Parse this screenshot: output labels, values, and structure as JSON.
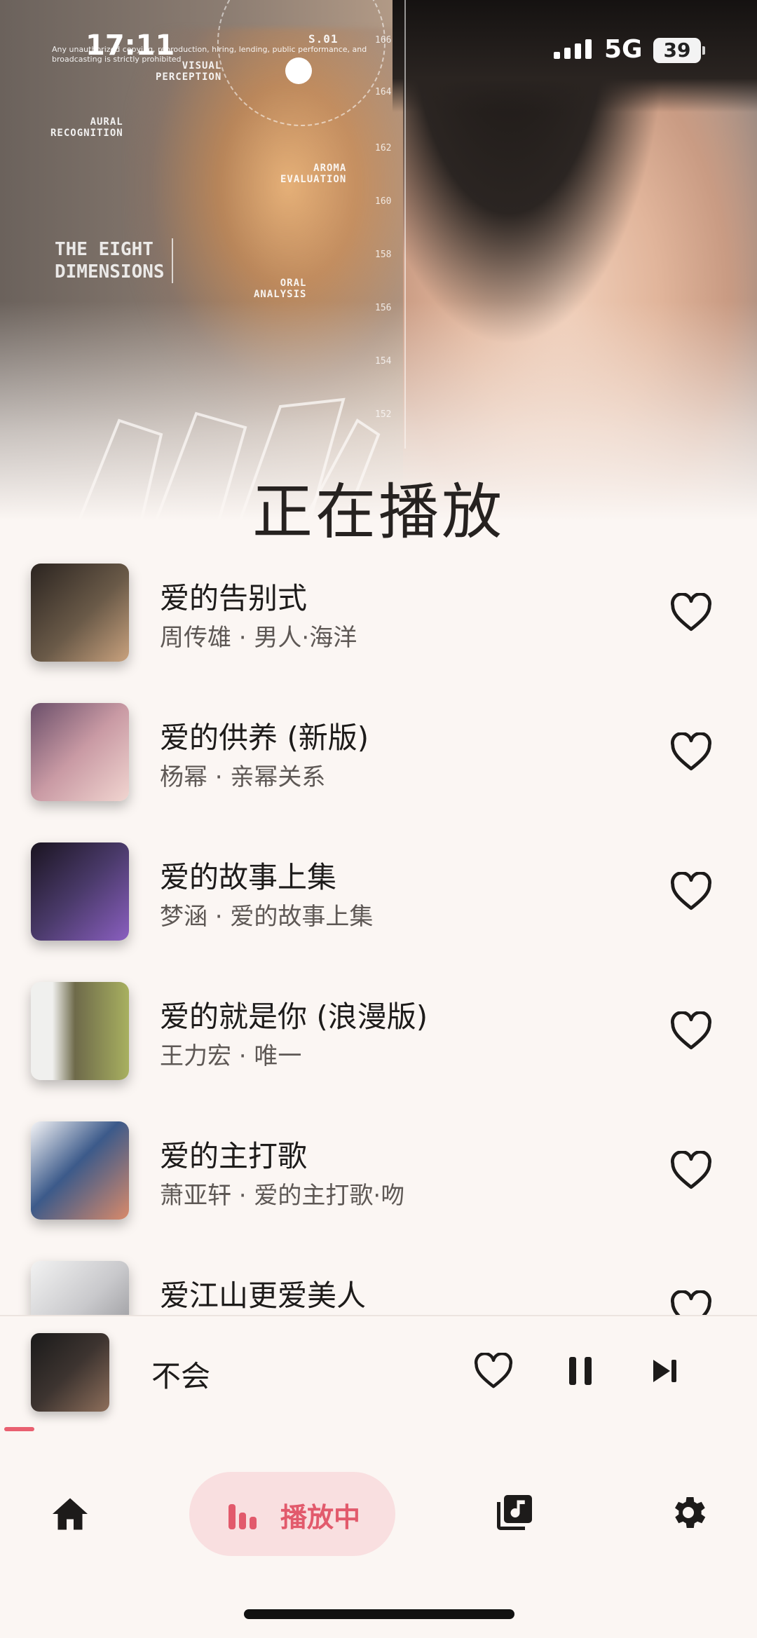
{
  "status_bar": {
    "time": "17:11",
    "network": "5G",
    "battery": "39",
    "signal_icon": "signal-icon"
  },
  "hero": {
    "title": "正在播放",
    "art_text": {
      "disclaimer": "Any unauthorized copying, reproduction, hiring, lending, public performance, and broadcasting is strictly prohibited",
      "visual_perception": "VISUAL\nPERCEPTION",
      "aural_recognition": "AURAL\nRECOGNITION",
      "aroma_evaluation": "AROMA\nEVALUATION",
      "oral_analysis": "ORAL\nANALYSIS",
      "eight_dimensions": "THE EIGHT\nDIMENSIONS",
      "scale_top": "S.01",
      "ticks": [
        "166",
        "164",
        "162",
        "160",
        "158",
        "156",
        "154",
        "152"
      ]
    }
  },
  "songs": [
    {
      "title": "爱的告别式",
      "subtitle": "周传雄 · 男人·海洋",
      "cover_colors": [
        "#2b2420",
        "#6a5a48",
        "#c9a27e"
      ]
    },
    {
      "title": "爱的供养 (新版)",
      "subtitle": "杨幂 · 亲幂关系",
      "cover_colors": [
        "#6b4f6a",
        "#c99aa4",
        "#f1d5d0"
      ]
    },
    {
      "title": "爱的故事上集",
      "subtitle": "梦涵 · 爱的故事上集",
      "cover_colors": [
        "#1a1420",
        "#4a3a6a",
        "#8a5fc0"
      ]
    },
    {
      "title": "爱的就是你 (浪漫版)",
      "subtitle": "王力宏 · 唯一",
      "cover_colors": [
        "#f0f0ee",
        "#6e6a4a",
        "#a8b060"
      ]
    },
    {
      "title": "爱的主打歌",
      "subtitle": "萧亚轩 · 爱的主打歌·吻",
      "cover_colors": [
        "#f4f4f6",
        "#3c5a8a",
        "#d98a6a"
      ]
    },
    {
      "title": "爱江山更爱美人",
      "subtitle": "",
      "cover_colors": [
        "#f2f2f2",
        "#c9c9cc",
        "#8a8a8e"
      ]
    }
  ],
  "mini_player": {
    "title": "不会",
    "progress": 0.04
  },
  "nav": {
    "home_icon": "home-icon",
    "playing_label": "播放中",
    "library_icon": "library-icon",
    "settings_icon": "settings-icon"
  },
  "colors": {
    "accent": "#e25a6c",
    "accent_bg": "#f9dfe0",
    "background": "#fbf6f3"
  }
}
